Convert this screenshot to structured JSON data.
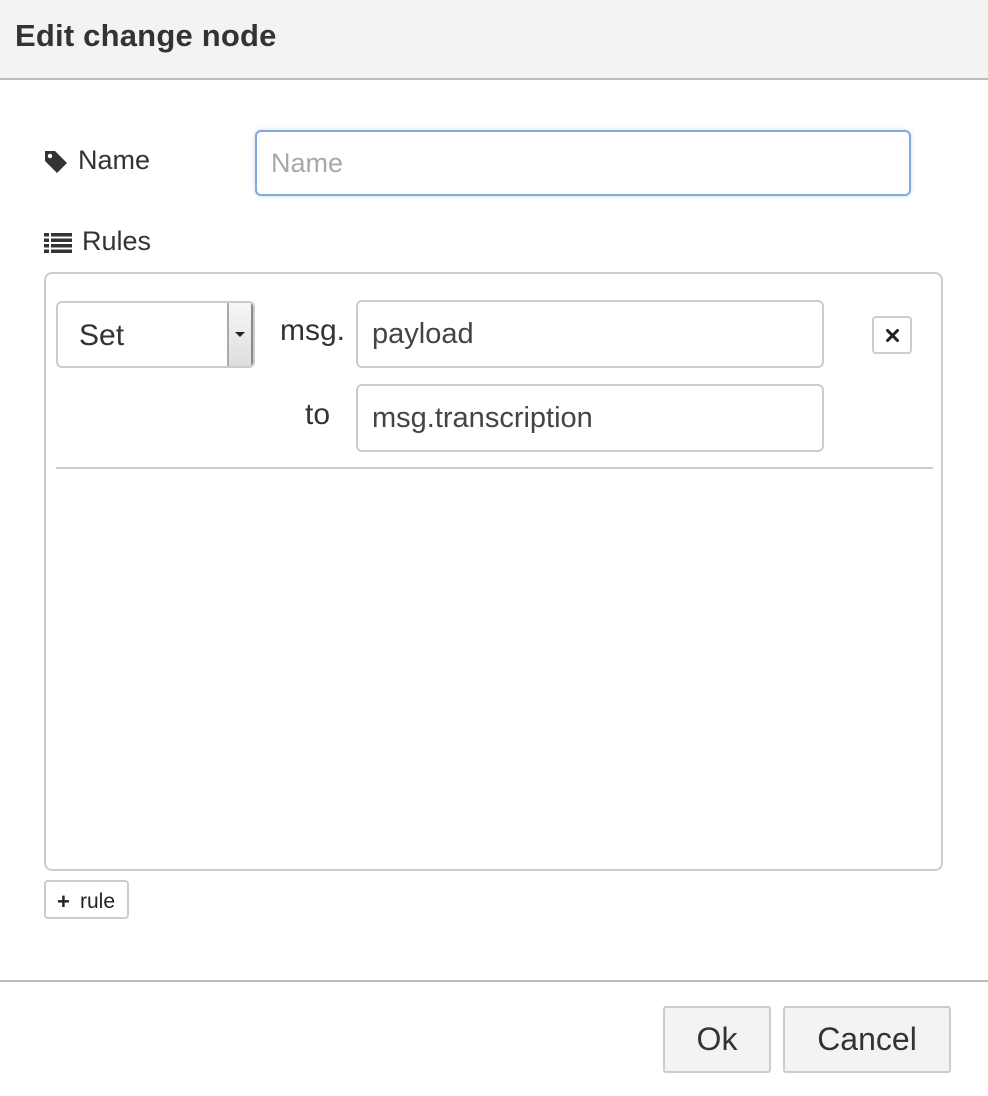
{
  "dialog": {
    "title": "Edit change node"
  },
  "name_field": {
    "label": "Name",
    "placeholder": "Name",
    "value": "",
    "icon": "tag-icon"
  },
  "rules": {
    "label": "Rules",
    "icon": "list-icon",
    "items": [
      {
        "action": "Set",
        "target_prefix": "msg.",
        "property": "payload",
        "to_label": "to",
        "to_value": "msg.transcription"
      }
    ],
    "add_rule_label": "rule"
  },
  "buttons": {
    "ok": "Ok",
    "cancel": "Cancel"
  },
  "colors": {
    "focus_border": "#85a8de",
    "titlebar_bg": "#f3f3f3",
    "border": "#cccccc"
  }
}
